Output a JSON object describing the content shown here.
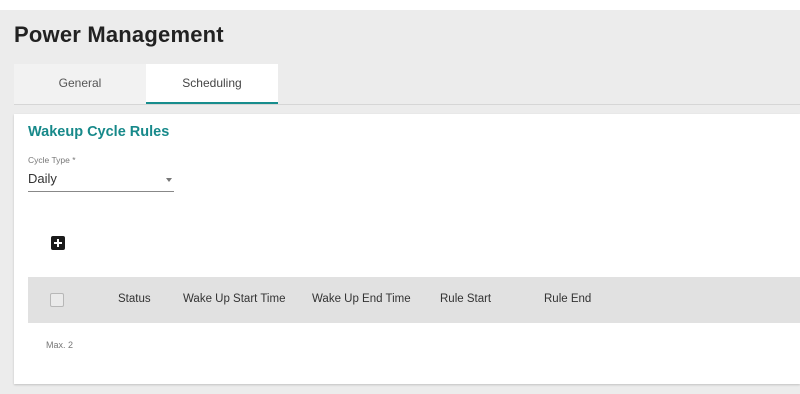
{
  "page": {
    "title": "Power Management"
  },
  "tabs": [
    {
      "label": "General",
      "active": false
    },
    {
      "label": "Scheduling",
      "active": true
    }
  ],
  "section": {
    "title": "Wakeup Cycle Rules",
    "cycle_type": {
      "label": "Cycle Type *",
      "value": "Daily"
    },
    "add_icon": "plus-box-icon"
  },
  "table": {
    "columns": [
      "Status",
      "Wake Up Start Time",
      "Wake Up End Time",
      "Rule Start",
      "Rule End"
    ],
    "rows": [],
    "footer": "Max. 2"
  },
  "colors": {
    "accent": "#178d8d"
  }
}
